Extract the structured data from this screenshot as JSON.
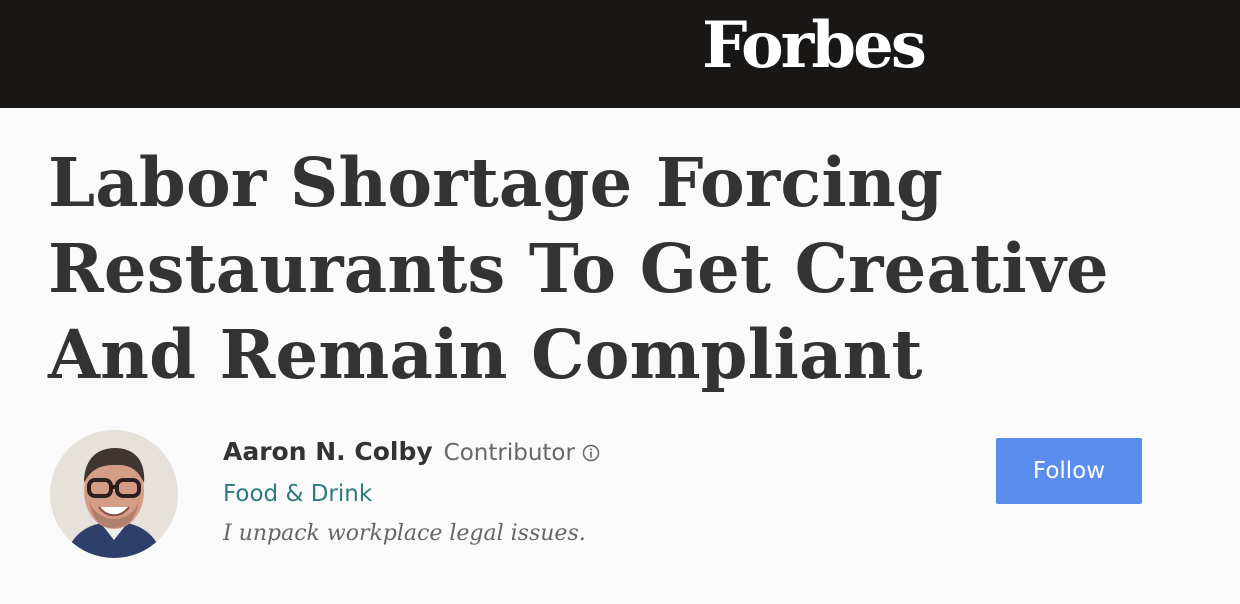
{
  "header": {
    "logo_text": "Forbes"
  },
  "article": {
    "title": "Labor Shortage Forcing Restaurants To Get Creative And Remain Compliant"
  },
  "author": {
    "name": "Aaron N. Colby",
    "role": "Contributor",
    "category": "Food & Drink",
    "bio": "I unpack workplace legal issues.",
    "follow_label": "Follow"
  },
  "colors": {
    "header_bg": "#181716",
    "headline": "#333333",
    "category_link": "#2c7b7f",
    "follow_button": "#5b8def"
  },
  "icons": {
    "info": "info-circle-icon",
    "avatar": "author-avatar"
  }
}
